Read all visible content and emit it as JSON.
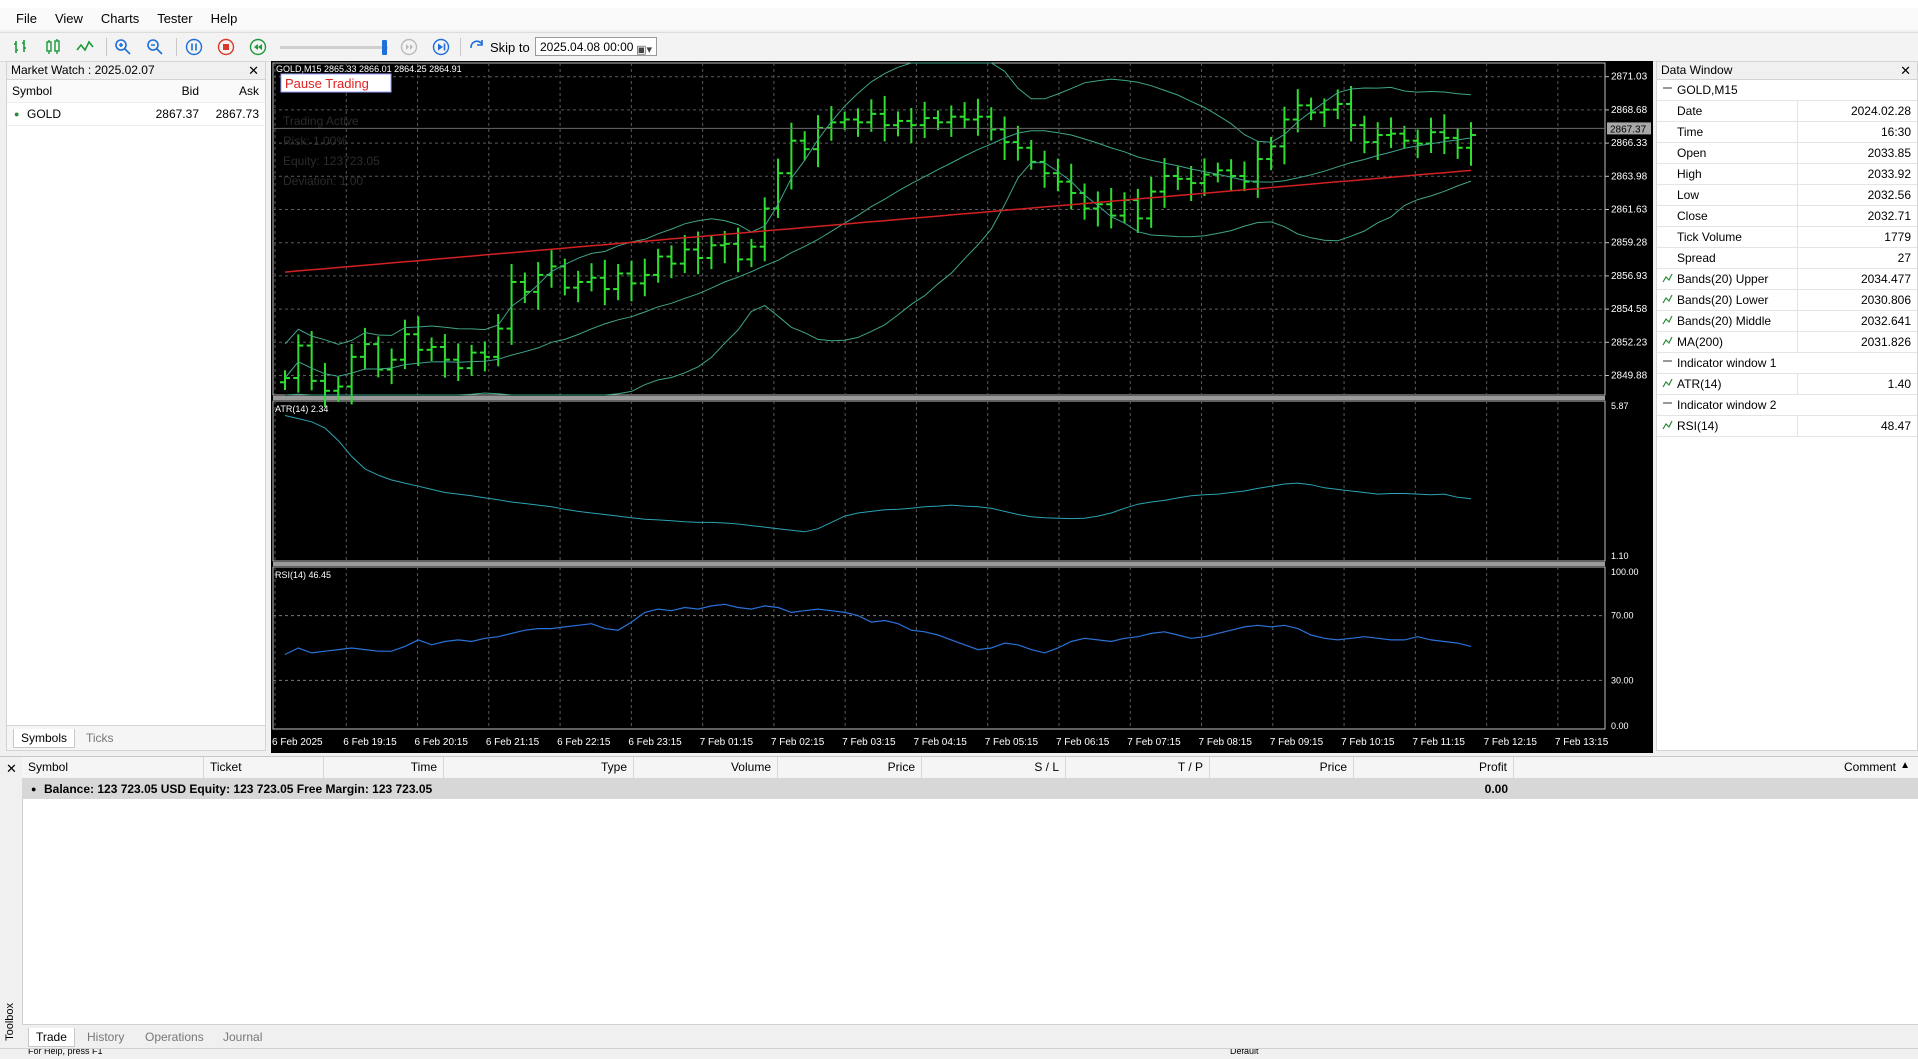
{
  "menu": [
    "File",
    "View",
    "Charts",
    "Tester",
    "Help"
  ],
  "toolbar": {
    "skip_label": "Skip to",
    "skip_date": "2025.04.08 00:00"
  },
  "market_watch": {
    "title": "Market Watch : 2025.02.07",
    "headers": {
      "symbol": "Symbol",
      "bid": "Bid",
      "ask": "Ask"
    },
    "rows": [
      {
        "symbol": "GOLD",
        "bid": "2867.37",
        "ask": "2867.73"
      }
    ],
    "tabs": [
      "Symbols",
      "Ticks"
    ]
  },
  "chart": {
    "header": "GOLD,M15  2865.33 2866.01 2864.25 2864.91",
    "pause_button": "Pause Trading",
    "ghost_text": [
      "Trading Active",
      "Risk: 1.00%",
      "Equity: 123723.05",
      "Deviation: 1.00"
    ],
    "current_price_tag": "2867.37",
    "price_ticks": [
      "2871.03",
      "2868.68",
      "2866.33",
      "2863.98",
      "2861.63",
      "2859.28",
      "2856.93",
      "2854.58",
      "2852.23",
      "2849.88"
    ],
    "atr_label": "ATR(14) 2.34",
    "atr_ticks": [
      "5.87",
      "1.10"
    ],
    "rsi_label": "RSI(14) 46.45",
    "rsi_ticks": [
      "100.00",
      "70.00",
      "30.00",
      "0.00"
    ],
    "time_ticks": [
      "6 Feb 2025",
      "6 Feb 19:15",
      "6 Feb 20:15",
      "6 Feb 21:15",
      "6 Feb 22:15",
      "6 Feb 23:15",
      "7 Feb 01:15",
      "7 Feb 02:15",
      "7 Feb 03:15",
      "7 Feb 04:15",
      "7 Feb 05:15",
      "7 Feb 06:15",
      "7 Feb 07:15",
      "7 Feb 08:15",
      "7 Feb 09:15",
      "7 Feb 10:15",
      "7 Feb 11:15",
      "7 Feb 12:15",
      "7 Feb 13:15"
    ]
  },
  "chart_data": {
    "type": "candlestick",
    "price_range": [
      2848.5,
      2872.0
    ],
    "closes": [
      2849.7,
      2852.0,
      2849.5,
      2848.8,
      2849.1,
      2851.2,
      2852.1,
      2850.3,
      2851.0,
      2852.8,
      2851.7,
      2851.9,
      2851.0,
      2850.4,
      2851.5,
      2851.2,
      2853.2,
      2856.5,
      2855.8,
      2857.0,
      2857.6,
      2856.1,
      2856.5,
      2856.8,
      2856.0,
      2857.1,
      2856.4,
      2857.0,
      2858.3,
      2857.8,
      2858.8,
      2858.2,
      2859.1,
      2859.2,
      2858.1,
      2859.0,
      2861.7,
      2864.2,
      2866.5,
      2865.9,
      2867.4,
      2867.8,
      2868.0,
      2867.8,
      2868.4,
      2867.6,
      2867.9,
      2867.6,
      2868.1,
      2867.8,
      2868.2,
      2868.0,
      2868.2,
      2867.3,
      2866.4,
      2866.0,
      2865.0,
      2864.2,
      2863.6,
      2862.8,
      2861.7,
      2862.0,
      2861.2,
      2862.3,
      2861.0,
      2862.9,
      2864.0,
      2863.8,
      2863.5,
      2864.1,
      2864.4,
      2864.0,
      2863.6,
      2865.2,
      2866.1,
      2868.0,
      2869.0,
      2868.5,
      2868.7,
      2869.1,
      2867.6,
      2866.4,
      2866.9,
      2867.0,
      2866.5,
      2866.3,
      2867.1,
      2866.7,
      2866.0,
      2866.9
    ],
    "atr_range": [
      1.1,
      5.87
    ],
    "atr": [
      5.6,
      5.5,
      5.4,
      5.2,
      4.8,
      4.3,
      3.9,
      3.7,
      3.55,
      3.45,
      3.35,
      3.25,
      3.15,
      3.1,
      3.05,
      2.98,
      2.92,
      2.85,
      2.8,
      2.75,
      2.7,
      2.62,
      2.55,
      2.5,
      2.45,
      2.4,
      2.35,
      2.3,
      2.28,
      2.25,
      2.22,
      2.2,
      2.2,
      2.18,
      2.15,
      2.1,
      2.05,
      2.0,
      1.95,
      1.9,
      2.0,
      2.2,
      2.4,
      2.5,
      2.55,
      2.6,
      2.62,
      2.65,
      2.7,
      2.72,
      2.75,
      2.72,
      2.7,
      2.65,
      2.55,
      2.45,
      2.38,
      2.35,
      2.33,
      2.32,
      2.33,
      2.4,
      2.5,
      2.65,
      2.78,
      2.85,
      2.9,
      2.98,
      3.05,
      3.08,
      3.1,
      3.15,
      3.2,
      3.28,
      3.35,
      3.42,
      3.45,
      3.4,
      3.3,
      3.25,
      3.2,
      3.15,
      3.1,
      3.12,
      3.12,
      3.1,
      3.08,
      3.1,
      3.0,
      2.95
    ],
    "rsi": [
      46,
      50,
      47,
      48,
      49,
      50,
      49,
      48,
      48,
      51,
      55,
      52,
      54,
      55,
      54,
      56,
      57,
      59,
      61,
      62,
      62,
      63,
      64,
      65,
      62,
      61,
      66,
      72,
      74,
      73,
      75,
      74,
      76,
      77,
      75,
      74,
      76,
      75,
      72,
      73,
      74,
      73,
      72,
      70,
      66,
      67,
      65,
      61,
      60,
      58,
      55,
      52,
      49,
      50,
      53,
      52,
      49,
      47,
      50,
      54,
      56,
      55,
      54,
      56,
      57,
      59,
      60,
      58,
      56,
      57,
      59,
      61,
      63,
      64,
      63,
      64,
      62,
      58,
      56,
      55,
      56,
      57,
      56,
      55,
      55,
      57,
      55,
      54,
      53,
      51
    ],
    "rsi_range": [
      0,
      100
    ]
  },
  "data_window": {
    "title": "Data Window",
    "symbol": "GOLD,M15",
    "rows": [
      {
        "k": "Date",
        "v": "2024.02.28"
      },
      {
        "k": "Time",
        "v": "16:30"
      },
      {
        "k": "Open",
        "v": "2033.85"
      },
      {
        "k": "High",
        "v": "2033.92"
      },
      {
        "k": "Low",
        "v": "2032.56"
      },
      {
        "k": "Close",
        "v": "2032.71"
      },
      {
        "k": "Tick Volume",
        "v": "1779"
      },
      {
        "k": "Spread",
        "v": "27"
      }
    ],
    "indicators": [
      {
        "k": "Bands(20) Upper",
        "v": "2034.477"
      },
      {
        "k": "Bands(20) Lower",
        "v": "2030.806"
      },
      {
        "k": "Bands(20) Middle",
        "v": "2032.641"
      },
      {
        "k": "MA(200)",
        "v": "2031.826"
      }
    ],
    "window1": "Indicator window 1",
    "atr": {
      "k": "ATR(14)",
      "v": "1.40"
    },
    "window2": "Indicator window 2",
    "rsi": {
      "k": "RSI(14)",
      "v": "48.47"
    }
  },
  "toolbox": {
    "side_label": "Toolbox",
    "columns": [
      "Symbol",
      "Ticket",
      "Time",
      "Type",
      "Volume",
      "Price",
      "S / L",
      "T / P",
      "Price",
      "Profit",
      "Comment"
    ],
    "balance_text": "Balance: 123 723.05 USD  Equity: 123 723.05  Free Margin: 123 723.05",
    "profit": "0.00",
    "tabs": [
      "Trade",
      "History",
      "Operations",
      "Journal"
    ]
  },
  "status": {
    "left": "For Help, press F1",
    "mid": "Default"
  }
}
